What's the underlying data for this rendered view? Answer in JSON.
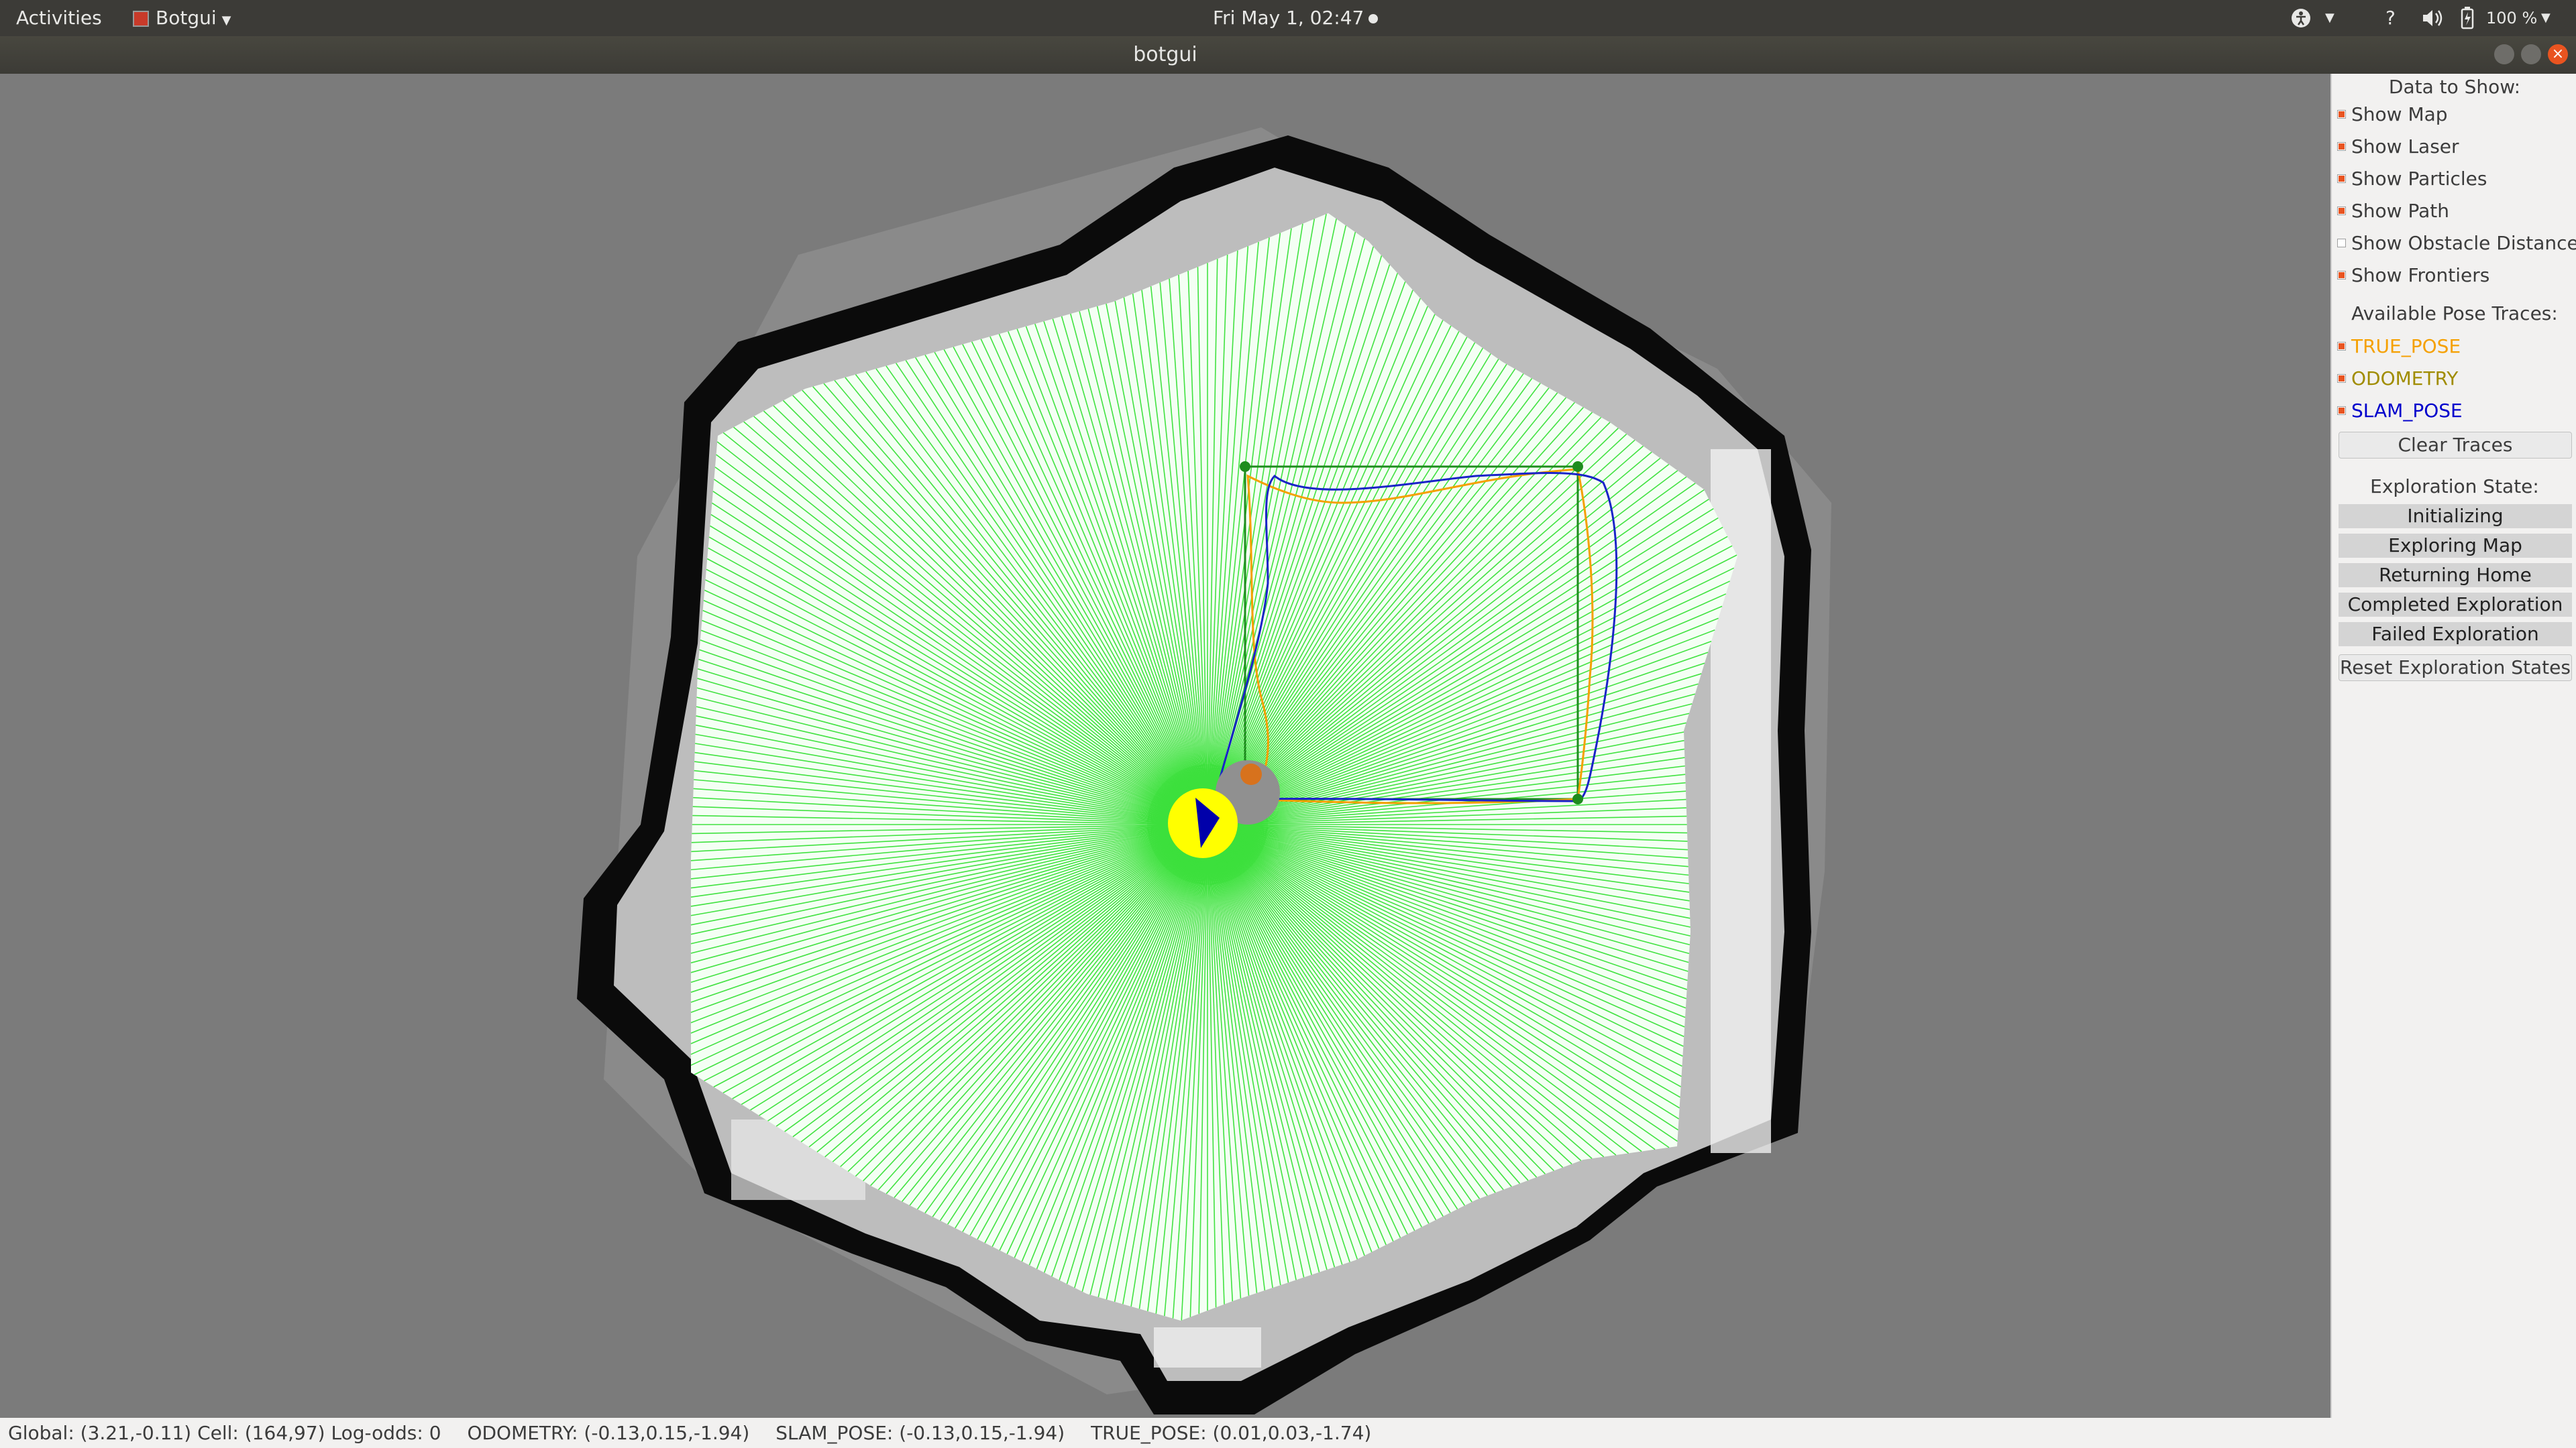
{
  "topbar": {
    "activities": "Activities",
    "app_name": "Botgui",
    "clock": "Fri May  1, 02:47",
    "question": "?",
    "battery": "100 %"
  },
  "window": {
    "title": "botgui"
  },
  "panel": {
    "data_title": "Data to Show:",
    "data_options": [
      {
        "label": "Show Map",
        "checked": true
      },
      {
        "label": "Show Laser",
        "checked": true
      },
      {
        "label": "Show Particles",
        "checked": true
      },
      {
        "label": "Show Path",
        "checked": true
      },
      {
        "label": "Show Obstacle Distances",
        "checked": false
      },
      {
        "label": "Show Frontiers",
        "checked": true
      }
    ],
    "traces_title": "Available Pose Traces:",
    "traces": [
      {
        "label": "TRUE_POSE",
        "checked": true,
        "color": "#f5a000"
      },
      {
        "label": "ODOMETRY",
        "checked": true,
        "color": "#a08c00"
      },
      {
        "label": "SLAM_POSE",
        "checked": true,
        "color": "#0000cc"
      }
    ],
    "clear_traces": "Clear Traces",
    "exploration_title": "Exploration State:",
    "states": [
      "Initializing",
      "Exploring Map",
      "Returning Home",
      "Completed Exploration",
      "Failed Exploration"
    ],
    "reset_states": "Reset Exploration States"
  },
  "status": {
    "global": "Global: (3.21,-0.11) Cell: (164,97) Log-odds: 0",
    "odometry": "ODOMETRY: (-0.13,0.15,-1.94)",
    "slam": "SLAM_POSE: (-0.13,0.15,-1.94)",
    "true_pose": "TRUE_POSE: (0.01,0.03,-1.74)"
  },
  "colors": {
    "laser": "#22dd22",
    "free_space": "#f4fff4",
    "wall": "#0b0b0b",
    "unknown": "#7b7b7b",
    "robot": "#ffff00",
    "heading": "#0000aa",
    "target_path": "#1e8c1e",
    "true_pose_trace": "#f5a000",
    "slam_trace": "#1a23c8",
    "home_marker": "#909090"
  }
}
